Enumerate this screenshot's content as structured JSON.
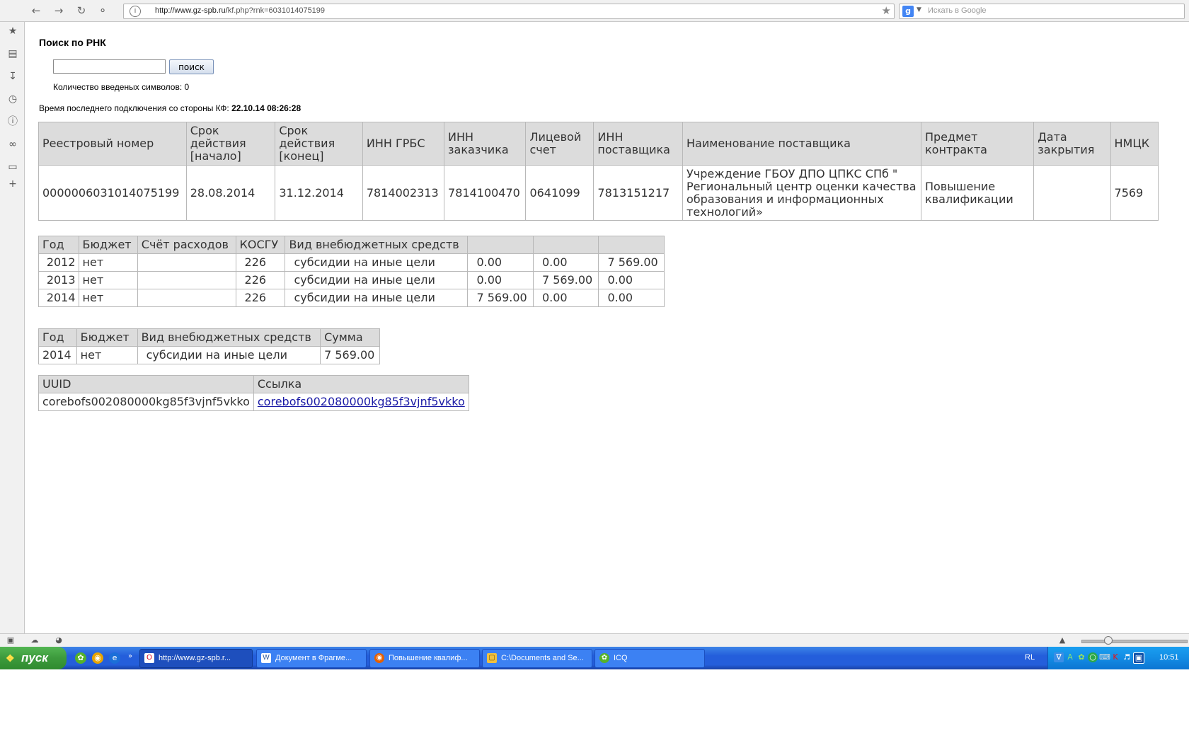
{
  "browser": {
    "url_domain": "http://www.gz-spb.ru/",
    "url_path": "kf.php?rnk=6031014075199",
    "search_placeholder": "Искать в Google"
  },
  "page": {
    "title": "Поиск по РНК",
    "search_value": "",
    "search_button": "поиск",
    "char_count_label": "Количество введеных символов: 0",
    "conn_label": "Время последнего подключения со стороны КФ:",
    "conn_time": "22.10.14 08:26:28"
  },
  "main_table": {
    "headers": [
      "Реестровый номер",
      "Срок действия [начало]",
      "Срок действия [конец]",
      "ИНН ГРБС",
      "ИНН заказчика",
      "Лицевой счет",
      "ИНН поставщика",
      "Наименование поставщика",
      "Предмет контракта",
      "Дата закрытия",
      "НМЦК"
    ],
    "row": [
      "0000006031014075199",
      "28.08.2014",
      "31.12.2014",
      "7814002313",
      "7814100470",
      "0641099",
      "7813151217",
      "Учреждение ГБОУ ДПО ЦПКС СПб \" Региональный центр оценки качества образования и информационных технологий»",
      "Повышение квалификации",
      "",
      "7569"
    ]
  },
  "years_table": {
    "headers": [
      "Год",
      "Бюджет",
      "Счёт расходов",
      "КОСГУ",
      "Вид внебюджетных средств",
      "",
      "",
      ""
    ],
    "rows": [
      [
        "2012",
        "нет",
        "",
        "226",
        "субсидии на иные цели",
        "0.00",
        "0.00",
        "7 569.00"
      ],
      [
        "2013",
        "нет",
        "",
        "226",
        "субсидии на иные цели",
        "0.00",
        "7 569.00",
        "0.00"
      ],
      [
        "2014",
        "нет",
        "",
        "226",
        "субсидии на иные цели",
        "7 569.00",
        "0.00",
        "0.00"
      ]
    ]
  },
  "sum_table": {
    "headers": [
      "Год",
      "Бюджет",
      "Вид внебюджетных средств",
      "Сумма"
    ],
    "row": [
      "2014",
      "нет",
      "субсидии на иные цели",
      "7 569.00"
    ]
  },
  "uuid_table": {
    "headers": [
      "UUID",
      "Ссылка"
    ],
    "uuid": "corebofs002080000kg85f3vjnf5vkko",
    "link": "corebofs002080000kg85f3vjnf5vkko"
  },
  "taskbar": {
    "start": "пуск",
    "tasks": [
      {
        "label": "http://www.gz-spb.r...",
        "icon": "opera-icon",
        "color": "#d6001c"
      },
      {
        "label": "Документ в Фрагме...",
        "icon": "word-document-icon",
        "color": "#2b5797"
      },
      {
        "label": "Повышение квалиф...",
        "icon": "firefox-icon",
        "color": "#e66000"
      },
      {
        "label": "C:\\Documents and Se...",
        "icon": "folder-icon",
        "color": "#f0c040"
      },
      {
        "label": "ICQ",
        "icon": "icq-flower-icon",
        "color": "#55b22a"
      }
    ],
    "lang": "RL",
    "clock": "10:51"
  },
  "colors": {
    "header_bg": "#dcdcdc",
    "link": "#1a1aa6",
    "taskbar": "#245edb",
    "start": "#3c9a3c"
  }
}
